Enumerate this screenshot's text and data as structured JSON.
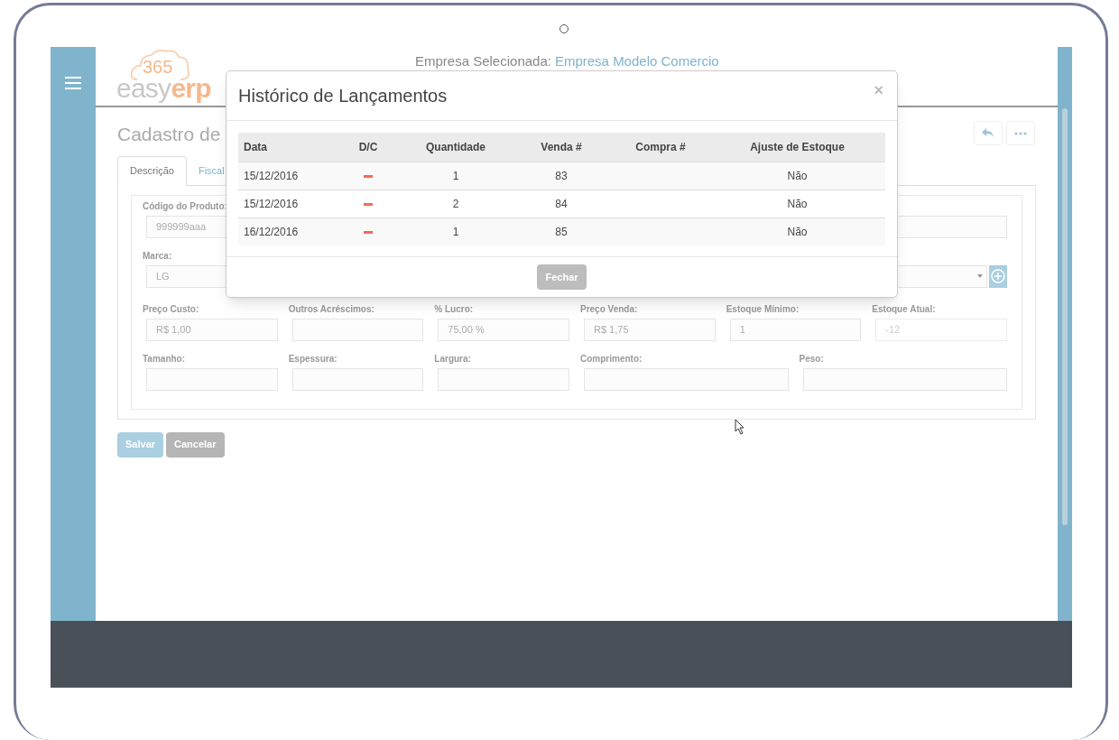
{
  "header": {
    "logo": {
      "number": "365",
      "word_light": "easy",
      "word_accent": "erp"
    },
    "company_label": "Empresa Selecionada:",
    "company_name": "Empresa Modelo Comercio"
  },
  "page": {
    "title": "Cadastro de",
    "tabs": [
      {
        "label": "Descrição",
        "selected": true
      },
      {
        "label": "Fiscal",
        "selected": false
      }
    ]
  },
  "form": {
    "rows": [
      [
        {
          "label": "Código do Produto:",
          "value": "999999aaa",
          "kind": "input"
        },
        {
          "kind": "input"
        }
      ],
      [
        {
          "label": "Marca:",
          "value": "LG",
          "kind": "input"
        },
        {
          "kind": "select"
        }
      ],
      [
        {
          "label": "Preço Custo:",
          "value": "R$ 1,00",
          "kind": "input"
        },
        {
          "label": "Outros Acréscimos:",
          "kind": "input"
        },
        {
          "label": "% Lucro:",
          "value": "75,00 %",
          "kind": "input"
        },
        {
          "label": "Preço Venda:",
          "value": "R$ 1,75",
          "kind": "input"
        },
        {
          "label": "Estoque Mínimo:",
          "value": "1",
          "kind": "input"
        },
        {
          "label": "Estoque Atual:",
          "value": "-12",
          "kind": "readonly"
        }
      ],
      [
        {
          "label": "Tamanho:",
          "kind": "input"
        },
        {
          "label": "Espessura:",
          "kind": "input"
        },
        {
          "label": "Largura:",
          "kind": "input"
        },
        {
          "label": "Comprimento:",
          "kind": "input"
        },
        {
          "label": "Peso:",
          "kind": "input"
        }
      ]
    ],
    "buttons": [
      {
        "label": "Salvar",
        "kind": "primary"
      },
      {
        "label": "Cancelar",
        "kind": "secondary"
      }
    ]
  },
  "modal": {
    "title": "Histórico de Lançamentos",
    "close": "×",
    "columns": [
      "Data",
      "D/C",
      "Quantidade",
      "Venda #",
      "Compra #",
      "Ajuste de Estoque"
    ],
    "rows": [
      {
        "data": "15/12/2016",
        "debit": true,
        "quantidade": "1",
        "venda": "83",
        "ajuste": "Não"
      },
      {
        "data": "15/12/2016",
        "debit": true,
        "quantidade": "2",
        "venda": "84",
        "ajuste": "Não"
      },
      {
        "data": "16/12/2016",
        "debit": true,
        "quantidade": "1",
        "venda": "85",
        "ajuste": "Não"
      }
    ],
    "button": "Fechar"
  }
}
